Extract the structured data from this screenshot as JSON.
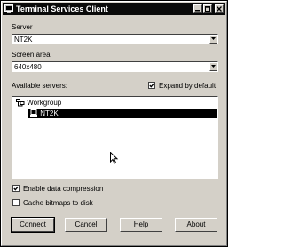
{
  "window": {
    "title": "Terminal Services Client"
  },
  "server": {
    "label": "Server",
    "value": "NT2K"
  },
  "screen_area": {
    "label": "Screen area",
    "value": "640x480"
  },
  "available_servers": {
    "label": "Available servers:",
    "expand_by_default": {
      "label": "Expand by default",
      "checked": true
    },
    "tree": [
      {
        "label": "Workgroup",
        "icon": "network-icon"
      },
      {
        "label": "NT2K",
        "icon": "computer-icon",
        "selected": true
      }
    ]
  },
  "options": {
    "enable_compression": {
      "label": "Enable data compression",
      "checked": true
    },
    "cache_bitmaps": {
      "label": "Cache bitmaps to disk",
      "checked": false
    }
  },
  "buttons": {
    "connect": "Connect",
    "cancel": "Cancel",
    "help": "Help",
    "about": "About"
  }
}
